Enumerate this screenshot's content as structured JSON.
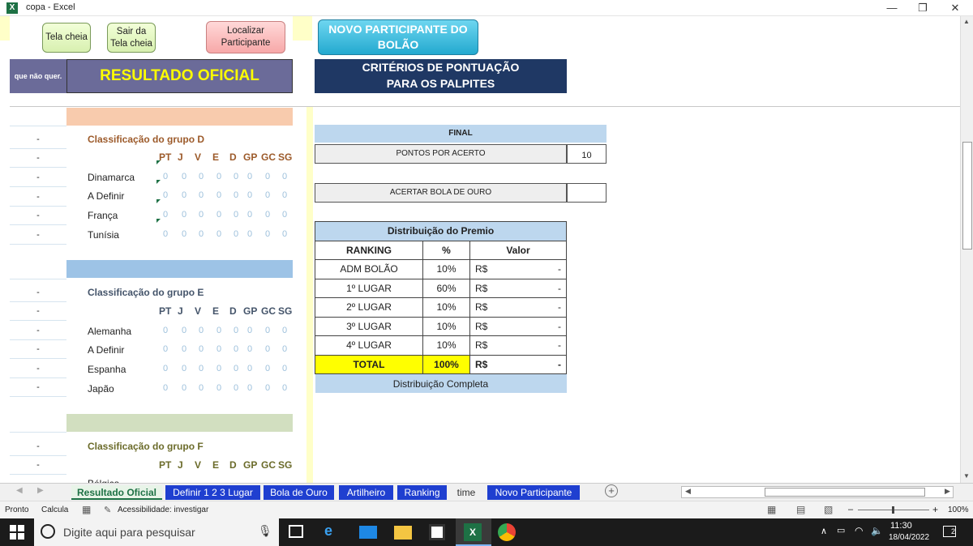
{
  "window": {
    "title": "copa - Excel",
    "minimize": "—",
    "restore": "❐",
    "close": "✕"
  },
  "buttons": {
    "tela_cheia": "Tela cheia",
    "sair_tela_cheia": "Sair da Tela cheia",
    "localizar": "Localizar Participante",
    "novo_participante": "NOVO PARTICIPANTE DO BOLÃO"
  },
  "banner": {
    "left_text": "que não quer.",
    "resultado": "RESULTADO OFICIAL",
    "criterios": "CRITÉRIOS DE PONTUAÇÃO PARA OS PALPITES"
  },
  "row_placeholder": "-",
  "stat_headers": [
    "PT",
    "J",
    "V",
    "E",
    "D",
    "GP",
    "GC",
    "SG"
  ],
  "groups": [
    {
      "title": "Classificação do grupo D",
      "teams": [
        "Dinamarca",
        "A Definir",
        "França",
        "Tunísia"
      ]
    },
    {
      "title": "Classificação do grupo E",
      "teams": [
        "Alemanha",
        "A Definir",
        "Espanha",
        "Japão"
      ]
    },
    {
      "title": "Classificação do grupo F",
      "teams": [
        "Bélgica"
      ]
    }
  ],
  "zero": "0",
  "criteria": {
    "final_label": "FINAL",
    "pontos_label": "PONTOS POR ACERTO",
    "pontos_value": "10",
    "bola_label": "ACERTAR  BOLA DE OURO"
  },
  "premio": {
    "title": "Distribuição do Premio",
    "headers": [
      "RANKING",
      "%",
      "Valor"
    ],
    "rows": [
      {
        "rank": "ADM BOLÃO",
        "pct": "10%",
        "cur": "R$",
        "val": "-"
      },
      {
        "rank": "1º LUGAR",
        "pct": "60%",
        "cur": "R$",
        "val": "-"
      },
      {
        "rank": "2º LUGAR",
        "pct": "10%",
        "cur": "R$",
        "val": "-"
      },
      {
        "rank": "3º LUGAR",
        "pct": "10%",
        "cur": "R$",
        "val": "-"
      },
      {
        "rank": "4º LUGAR",
        "pct": "10%",
        "cur": "R$",
        "val": "-"
      }
    ],
    "total": {
      "rank": "TOTAL",
      "pct": "100%",
      "cur": "R$",
      "val": "-"
    },
    "footer": "Distribuição Completa"
  },
  "tabs": [
    "Resultado Oficial",
    "Definir 1 2 3 Lugar",
    "Bola de Ouro",
    "Artilheiro",
    "Ranking",
    "time",
    "Novo Participante"
  ],
  "status": {
    "ready": "Pronto",
    "calc": "Calcula",
    "access": "Acessibilidade: investigar",
    "zoom": "100%"
  },
  "taskbar": {
    "search_placeholder": "Digite aqui para pesquisar",
    "time": "11:30",
    "date": "18/04/2022",
    "notif": "2"
  }
}
